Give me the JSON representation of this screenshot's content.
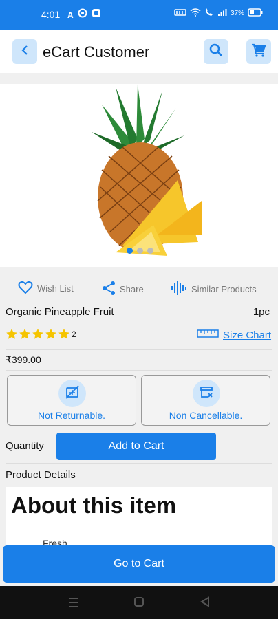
{
  "status_bar": {
    "time": "4:01",
    "battery_text": "37%",
    "left_icons": [
      "a-icon",
      "settings-icon",
      "app-icon"
    ],
    "right_icons": [
      "nfc-icon",
      "wifi-icon",
      "call-icon",
      "signal-icon",
      "battery-icon"
    ]
  },
  "app_bar": {
    "title": "eCart Customer",
    "icons": [
      "back-icon",
      "search-icon",
      "cart-icon"
    ]
  },
  "carousel": {
    "image_icon": "pineapple-image",
    "dot_count": 3,
    "active_index": 0
  },
  "actions": {
    "wishlist": "Wish List",
    "share": "Share",
    "similar": "Similar Products"
  },
  "product": {
    "name": "Organic Pineapple Fruit",
    "unit": "1pc",
    "rating": 5,
    "rating_count": "2",
    "size_chart": "Size Chart",
    "price": "₹399.00"
  },
  "policies": {
    "returnable": "Not Returnable.",
    "cancellable": "Non Cancellable."
  },
  "purchase": {
    "quantity_label": "Quantity",
    "add_to_cart": "Add to Cart"
  },
  "details": {
    "section_title": "Product Details",
    "heading": "About this item",
    "first_bullet": "Fresh"
  },
  "footer": {
    "go_to_cart": "Go to Cart"
  },
  "colors": {
    "primary": "#1a7fe8",
    "light_blue": "#cfe6fb",
    "star": "#f5c400"
  }
}
